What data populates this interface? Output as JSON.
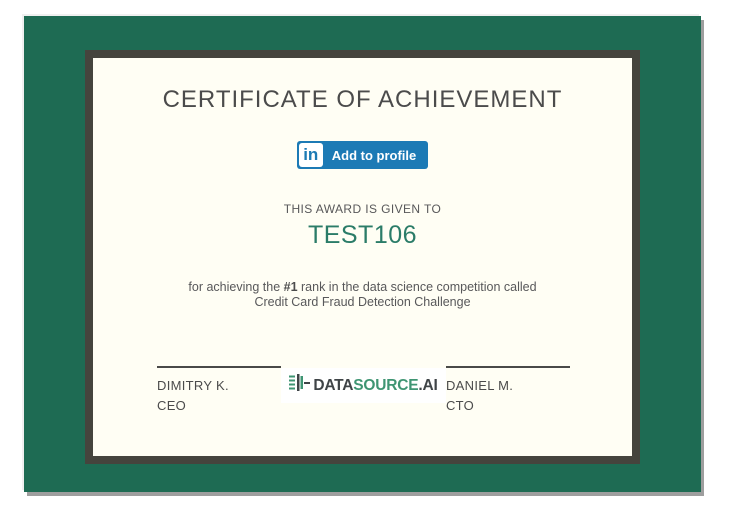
{
  "certificate": {
    "title": "CERTIFICATE OF ACHIEVEMENT",
    "linkedin_button": {
      "icon_text": "in",
      "label": "Add to profile",
      "color": "#1c7ab5"
    },
    "award_intro": "THIS AWARD IS GIVEN TO",
    "recipient": "TEST106",
    "description": {
      "prefix": "for achieving the ",
      "rank": "#1",
      "suffix": " rank in the data science competition called",
      "competition": "Credit Card Fraud Detection Challenge"
    },
    "signatories": [
      {
        "name": "DIMITRY K.",
        "title": "CEO"
      },
      {
        "name": "DANIEL M.",
        "title": "CTO"
      }
    ],
    "logo": {
      "icon": "datasource-logo-icon",
      "part1": "DATA",
      "part2": "SOURCE",
      "part3": ".AI"
    },
    "colors": {
      "frame_green": "#1e6b53",
      "inner_border": "#45443d",
      "paper": "#fffef4",
      "recipient_teal": "#2b7c68",
      "linkedin_blue": "#1c7ab5",
      "logo_green": "#3f9573",
      "text_gray": "#58585a"
    }
  }
}
